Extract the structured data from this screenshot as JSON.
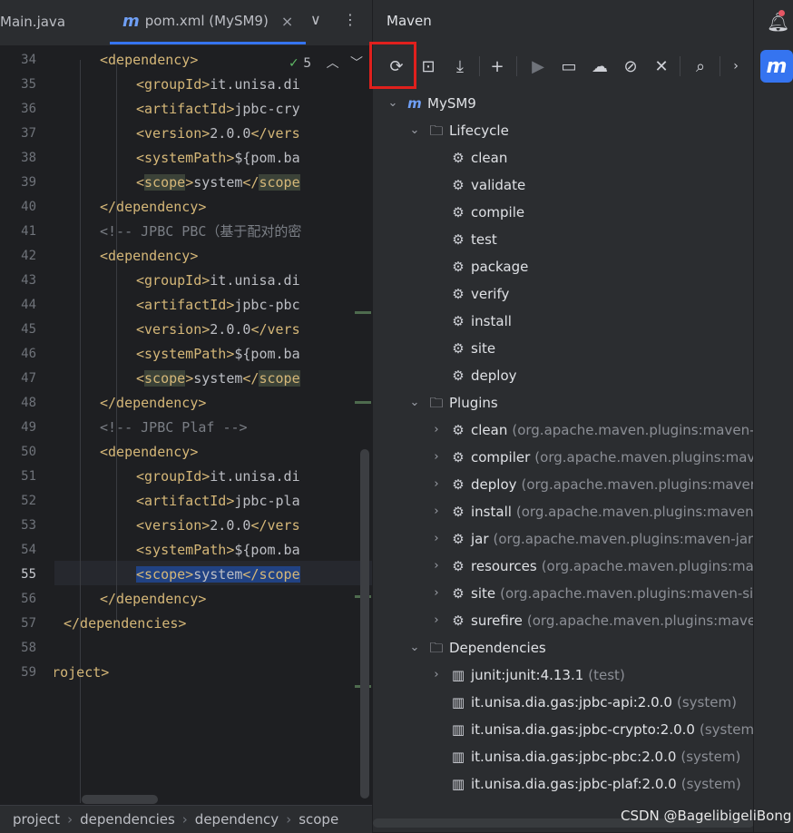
{
  "tabs": [
    {
      "label": "Main.java"
    },
    {
      "label": "pom.xml (MySM9)"
    }
  ],
  "tabbar": {
    "chevron": "∨",
    "more": "⋮",
    "close": "×"
  },
  "inspection": {
    "count": "5"
  },
  "lines": [
    {
      "n": "34",
      "code": [
        {
          "c": "tag",
          "t": "<dependency>"
        }
      ]
    },
    {
      "n": "35",
      "code": [
        {
          "c": "tag",
          "t": "<groupId>"
        },
        {
          "c": "txt",
          "t": "it.unisa.di"
        }
      ]
    },
    {
      "n": "36",
      "code": [
        {
          "c": "tag",
          "t": "<artifactId>"
        },
        {
          "c": "txt",
          "t": "jpbc-cry"
        }
      ]
    },
    {
      "n": "37",
      "code": [
        {
          "c": "tag",
          "t": "<version>"
        },
        {
          "c": "txt",
          "t": "2.0.0"
        },
        {
          "c": "tag",
          "t": "</vers"
        }
      ]
    },
    {
      "n": "38",
      "code": [
        {
          "c": "tag",
          "t": "<systemPath>"
        },
        {
          "c": "txt",
          "t": "${pom.ba"
        }
      ]
    },
    {
      "n": "39",
      "code": [
        {
          "c": "tag",
          "t": "<"
        },
        {
          "c": "tag scopehl",
          "t": "scope"
        },
        {
          "c": "tag",
          "t": ">"
        },
        {
          "c": "txt",
          "t": "system"
        },
        {
          "c": "tag",
          "t": "</"
        },
        {
          "c": "tag scopehl",
          "t": "scope"
        }
      ]
    },
    {
      "n": "40",
      "code": [
        {
          "c": "tag",
          "t": "</dependency>"
        }
      ]
    },
    {
      "n": "41",
      "code": [
        {
          "c": "cmt",
          "t": "<!-- JPBC PBC（基于配对的密"
        }
      ]
    },
    {
      "n": "42",
      "code": [
        {
          "c": "tag",
          "t": "<dependency>"
        }
      ]
    },
    {
      "n": "43",
      "code": [
        {
          "c": "tag",
          "t": "<groupId>"
        },
        {
          "c": "txt",
          "t": "it.unisa.di"
        }
      ]
    },
    {
      "n": "44",
      "code": [
        {
          "c": "tag",
          "t": "<artifactId>"
        },
        {
          "c": "txt",
          "t": "jpbc-pbc"
        }
      ]
    },
    {
      "n": "45",
      "code": [
        {
          "c": "tag",
          "t": "<version>"
        },
        {
          "c": "txt",
          "t": "2.0.0"
        },
        {
          "c": "tag",
          "t": "</vers"
        }
      ]
    },
    {
      "n": "46",
      "code": [
        {
          "c": "tag",
          "t": "<systemPath>"
        },
        {
          "c": "txt",
          "t": "${pom.ba"
        }
      ]
    },
    {
      "n": "47",
      "code": [
        {
          "c": "tag",
          "t": "<"
        },
        {
          "c": "tag scopehl",
          "t": "scope"
        },
        {
          "c": "tag",
          "t": ">"
        },
        {
          "c": "txt",
          "t": "system"
        },
        {
          "c": "tag",
          "t": "</"
        },
        {
          "c": "tag scopehl",
          "t": "scope"
        }
      ]
    },
    {
      "n": "48",
      "code": [
        {
          "c": "tag",
          "t": "</dependency>"
        }
      ]
    },
    {
      "n": "49",
      "code": [
        {
          "c": "cmt",
          "t": "<!-- JPBC Plaf -->"
        }
      ]
    },
    {
      "n": "50",
      "code": [
        {
          "c": "tag",
          "t": "<dependency>"
        }
      ]
    },
    {
      "n": "51",
      "code": [
        {
          "c": "tag",
          "t": "<groupId>"
        },
        {
          "c": "txt",
          "t": "it.unisa.di"
        }
      ]
    },
    {
      "n": "52",
      "code": [
        {
          "c": "tag",
          "t": "<artifactId>"
        },
        {
          "c": "txt",
          "t": "jpbc-pla"
        }
      ]
    },
    {
      "n": "53",
      "code": [
        {
          "c": "tag",
          "t": "<version>"
        },
        {
          "c": "txt",
          "t": "2.0.0"
        },
        {
          "c": "tag",
          "t": "</vers"
        }
      ]
    },
    {
      "n": "54",
      "code": [
        {
          "c": "tag",
          "t": "<systemPath>"
        },
        {
          "c": "txt",
          "t": "${pom.ba"
        }
      ]
    },
    {
      "n": "55",
      "code": [
        {
          "c": "tag sel",
          "t": "<scope>"
        },
        {
          "c": "txt sel",
          "t": "system"
        },
        {
          "c": "tag sel",
          "t": "</scope"
        }
      ]
    },
    {
      "n": "56",
      "code": [
        {
          "c": "tag",
          "t": "</dependency>"
        }
      ]
    },
    {
      "n": "57",
      "code": [
        {
          "c": "tag",
          "t": "</dependencies>"
        }
      ]
    },
    {
      "n": "58",
      "code": []
    },
    {
      "n": "59",
      "code": [
        {
          "c": "tag",
          "t": "</project>"
        }
      ]
    }
  ],
  "breadcrumb": [
    "project",
    "dependencies",
    "dependency",
    "scope"
  ],
  "maven": {
    "title": "Maven",
    "project": "MySM9",
    "lifecycle": {
      "label": "Lifecycle",
      "goals": [
        "clean",
        "validate",
        "compile",
        "test",
        "package",
        "verify",
        "install",
        "site",
        "deploy"
      ]
    },
    "plugins": {
      "label": "Plugins",
      "items": [
        {
          "name": "clean",
          "detail": "(org.apache.maven.plugins:maven-cle"
        },
        {
          "name": "compiler",
          "detail": "(org.apache.maven.plugins:maven"
        },
        {
          "name": "deploy",
          "detail": "(org.apache.maven.plugins:maven-d"
        },
        {
          "name": "install",
          "detail": "(org.apache.maven.plugins:maven-in"
        },
        {
          "name": "jar",
          "detail": "(org.apache.maven.plugins:maven-jar-pl"
        },
        {
          "name": "resources",
          "detail": "(org.apache.maven.plugins:mave"
        },
        {
          "name": "site",
          "detail": "(org.apache.maven.plugins:maven-site-"
        },
        {
          "name": "surefire",
          "detail": "(org.apache.maven.plugins:maven-"
        }
      ]
    },
    "dependencies": {
      "label": "Dependencies",
      "items": [
        {
          "name": "junit:junit:4.13.1",
          "scope": "(test)",
          "expandable": true
        },
        {
          "name": "it.unisa.dia.gas:jpbc-api:2.0.0",
          "scope": "(system)",
          "expandable": false
        },
        {
          "name": "it.unisa.dia.gas:jpbc-crypto:2.0.0",
          "scope": "(system)",
          "expandable": false
        },
        {
          "name": "it.unisa.dia.gas:jpbc-pbc:2.0.0",
          "scope": "(system)",
          "expandable": false
        },
        {
          "name": "it.unisa.dia.gas:jpbc-plaf:2.0.0",
          "scope": "(system)",
          "expandable": false
        }
      ]
    }
  },
  "watermark": "CSDN @BagelibigeliBong",
  "colors": {
    "accent": "#3574f0",
    "highlight": "#e0201d",
    "tag": "#d5b778",
    "comment": "#7a7e85"
  }
}
